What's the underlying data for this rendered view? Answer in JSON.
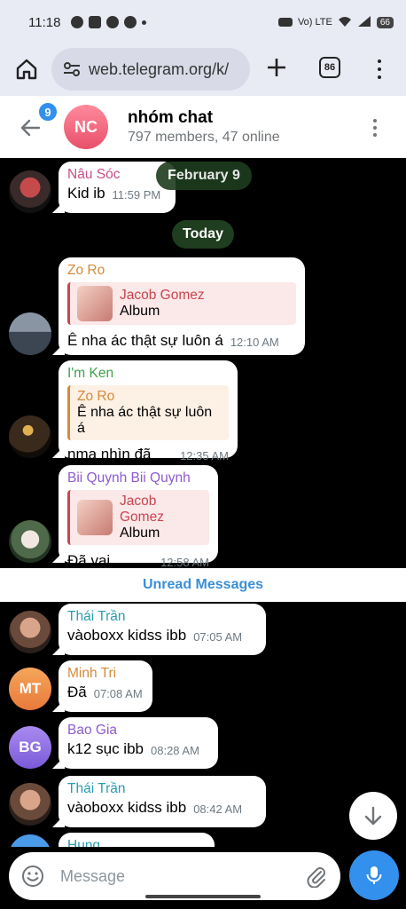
{
  "status_bar": {
    "time": "11:18",
    "network": "Vo) LTE",
    "battery": "66"
  },
  "browser": {
    "url": "web.telegram.org/k/",
    "tab_count": "86"
  },
  "chat": {
    "unread_count": "9",
    "avatar_initials": "NC",
    "title": "nhóm chat",
    "subtitle": "797 members, 47 online"
  },
  "dates": {
    "floating": "February 9",
    "today": "Today"
  },
  "messages": [
    {
      "sender": "Nâu Sóc",
      "text": "Kid ib",
      "time": "11:59 PM"
    },
    {
      "sender": "Zo Ro",
      "reply_author": "Jacob Gomez",
      "reply_text": "Album",
      "text": "Ê nha ác thật sự luôn á",
      "time": "12:10 AM"
    },
    {
      "sender": "I'm Ken",
      "reply_author": "Zo Ro",
      "reply_text": "Ê nha ác thật sự luôn á",
      "text": "nma nhìn đã",
      "time": "12:35 AM"
    },
    {
      "sender": "Bii Quynh Bii Quynh",
      "reply_author": "Jacob Gomez",
      "reply_text": "Album",
      "text": "Đã vai",
      "time": "12:58 AM"
    },
    {
      "sender": "Thái Trần",
      "text": "vàoboxx kidss ibb",
      "time": "07:05 AM"
    },
    {
      "sender": "Minh Tri",
      "avatar_initials": "MT",
      "text": "Đã",
      "time": "07:08 AM"
    },
    {
      "sender": "Bao Gia",
      "avatar_initials": "BG",
      "text": "k12 sục ibb",
      "time": "08:28 AM"
    },
    {
      "sender": "Thái Trần",
      "text": "vàoboxx kidss ibb",
      "time": "08:42 AM"
    },
    {
      "sender": "Hung"
    }
  ],
  "unread_divider": "Unread Messages",
  "composer": {
    "placeholder": "Message"
  },
  "colors": {
    "accent": "#3390ec",
    "date_pill": "#1f3d1f",
    "sender_pink": "#c8508a",
    "sender_orange": "#d68a3a",
    "sender_green": "#3ea34a",
    "sender_purple": "#8e5bd0",
    "sender_teal": "#2b9cb0"
  }
}
